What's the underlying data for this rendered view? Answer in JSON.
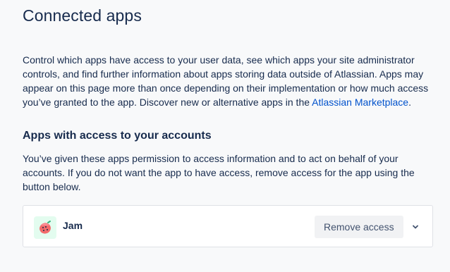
{
  "page": {
    "title": "Connected apps",
    "intro_text": "Control which apps have access to your user data, see which apps your site administrator controls, and find further information about apps storing data outside of Atlassian. Apps may appear on this page more than once depending on their implementation or how much access you’ve granted to the app. Discover new or alternative apps in the ",
    "intro_link": "Atlassian Marketplace",
    "intro_suffix": "."
  },
  "section": {
    "title": "Apps with access to your accounts",
    "description": "You’ve given these apps permission to access information and to act on behalf of your accounts. If you do not want the app to have access, remove access for the app using the button below."
  },
  "apps": [
    {
      "name": "Jam",
      "icon": "jam-logo-icon",
      "remove_label": "Remove access",
      "expand_icon": "chevron-down-icon"
    }
  ],
  "colors": {
    "link": "#0052cc",
    "text": "#172b4d",
    "button_bg": "#f1f2f4",
    "icon_bg": "#e3fcef"
  }
}
